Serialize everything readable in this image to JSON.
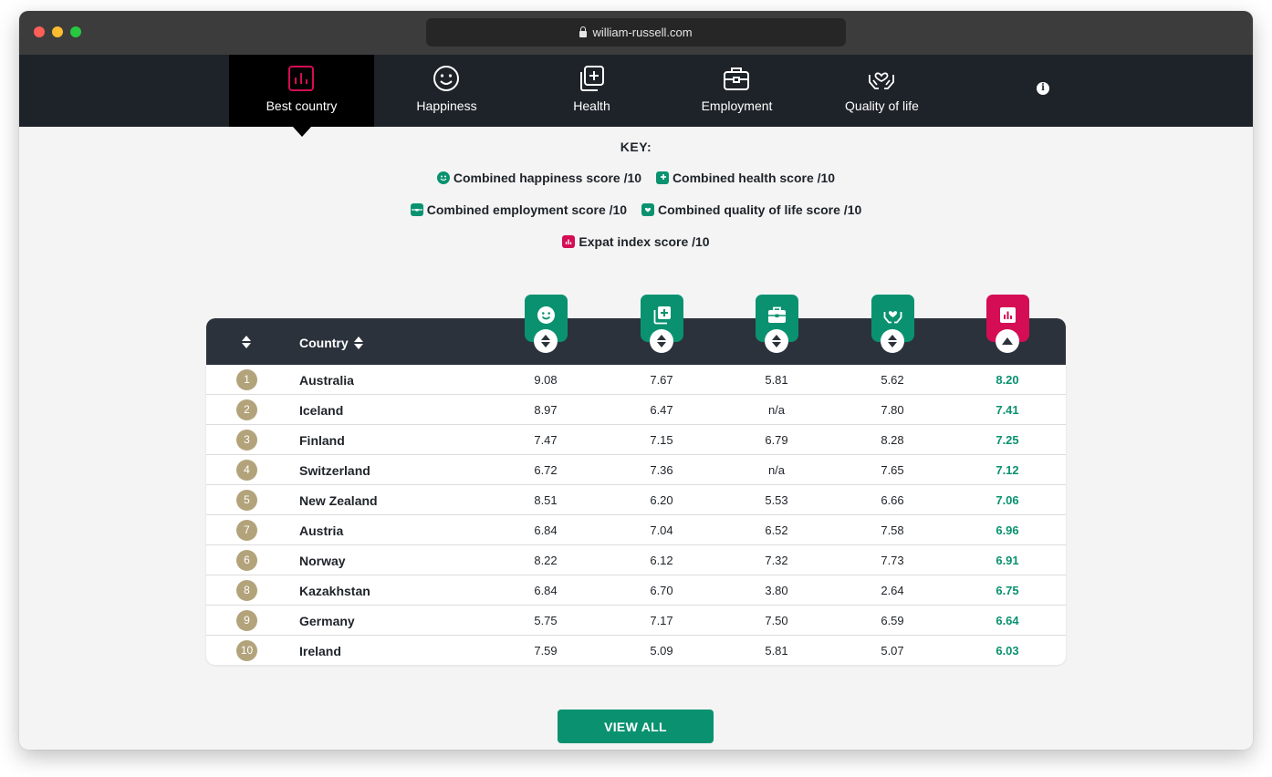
{
  "browser": {
    "url": "william-russell.com"
  },
  "nav": {
    "tabs": [
      {
        "label": "Best country",
        "icon": "bar-chart-icon",
        "active": true
      },
      {
        "label": "Happiness",
        "icon": "smiley-icon",
        "active": false
      },
      {
        "label": "Health",
        "icon": "medical-plus-icon",
        "active": false
      },
      {
        "label": "Employment",
        "icon": "briefcase-icon",
        "active": false
      },
      {
        "label": "Quality of life",
        "icon": "hands-heart-icon",
        "active": false
      }
    ],
    "info_icon": "info-icon"
  },
  "key": {
    "title": "KEY:",
    "items": [
      {
        "label": "Combined happiness score /10",
        "icon": "smiley-icon",
        "color": "#0a9270"
      },
      {
        "label": "Combined health score /10",
        "icon": "medical-plus-icon",
        "color": "#0a9270"
      },
      {
        "label": "Combined employment score /10",
        "icon": "briefcase-icon",
        "color": "#0a9270"
      },
      {
        "label": "Combined quality of life score /10",
        "icon": "hands-heart-icon",
        "color": "#0a9270"
      },
      {
        "label": "Expat index score /10",
        "icon": "bar-chart-icon",
        "color": "#d40d54"
      }
    ]
  },
  "table": {
    "country_header": "Country",
    "rows": [
      {
        "rank": "1",
        "country": "Australia",
        "happiness": "9.08",
        "health": "7.67",
        "employment": "5.81",
        "quality": "5.62",
        "expat": "8.20"
      },
      {
        "rank": "2",
        "country": "Iceland",
        "happiness": "8.97",
        "health": "6.47",
        "employment": "n/a",
        "quality": "7.80",
        "expat": "7.41"
      },
      {
        "rank": "3",
        "country": "Finland",
        "happiness": "7.47",
        "health": "7.15",
        "employment": "6.79",
        "quality": "8.28",
        "expat": "7.25"
      },
      {
        "rank": "4",
        "country": "Switzerland",
        "happiness": "6.72",
        "health": "7.36",
        "employment": "n/a",
        "quality": "7.65",
        "expat": "7.12"
      },
      {
        "rank": "5",
        "country": "New Zealand",
        "happiness": "8.51",
        "health": "6.20",
        "employment": "5.53",
        "quality": "6.66",
        "expat": "7.06"
      },
      {
        "rank": "7",
        "country": "Austria",
        "happiness": "6.84",
        "health": "7.04",
        "employment": "6.52",
        "quality": "7.58",
        "expat": "6.96"
      },
      {
        "rank": "6",
        "country": "Norway",
        "happiness": "8.22",
        "health": "6.12",
        "employment": "7.32",
        "quality": "7.73",
        "expat": "6.91"
      },
      {
        "rank": "8",
        "country": "Kazakhstan",
        "happiness": "6.84",
        "health": "6.70",
        "employment": "3.80",
        "quality": "2.64",
        "expat": "6.75"
      },
      {
        "rank": "9",
        "country": "Germany",
        "happiness": "5.75",
        "health": "7.17",
        "employment": "7.50",
        "quality": "6.59",
        "expat": "6.64"
      },
      {
        "rank": "10",
        "country": "Ireland",
        "happiness": "7.59",
        "health": "5.09",
        "employment": "5.81",
        "quality": "5.07",
        "expat": "6.03"
      }
    ]
  },
  "view_all_label": "VIEW ALL",
  "colors": {
    "green": "#0a9270",
    "pink": "#d40d54",
    "nav_bg": "#1e2329",
    "rank_badge": "#b3a37b"
  }
}
